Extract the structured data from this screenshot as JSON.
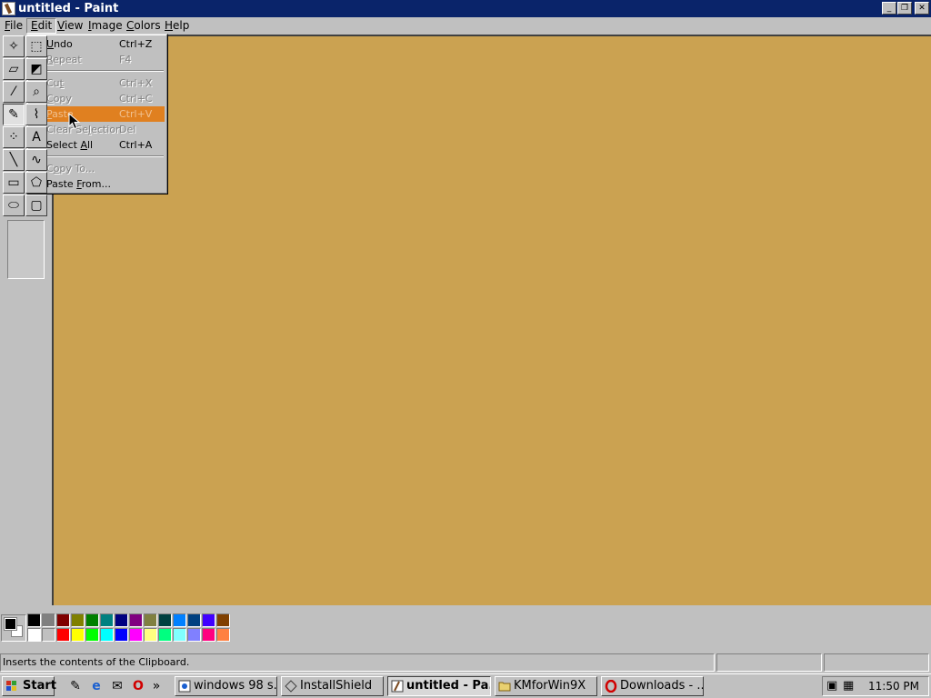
{
  "window": {
    "title": "untitled - Paint",
    "buttons": {
      "minimize": "_",
      "restore": "❐",
      "close": "✕"
    }
  },
  "menubar": {
    "file": {
      "first": "F",
      "rest": "ile"
    },
    "edit": {
      "first": "E",
      "rest": "dit"
    },
    "view": {
      "first": "V",
      "rest": "iew"
    },
    "image": {
      "first": "I",
      "rest": "mage"
    },
    "colors": {
      "first": "C",
      "rest": "olors"
    },
    "help": {
      "first": "H",
      "rest": "elp"
    }
  },
  "edit_menu": {
    "undo": {
      "first": "U",
      "rest": "ndo",
      "shortcut": "Ctrl+Z"
    },
    "repeat": {
      "first": "R",
      "rest": "epeat",
      "shortcut": "F4"
    },
    "cut": {
      "pre": "Cu",
      "ul": "t",
      "shortcut": "Ctrl+X"
    },
    "copy": {
      "first": "C",
      "rest": "opy",
      "shortcut": "Ctrl+C"
    },
    "paste": {
      "first": "P",
      "rest": "aste",
      "shortcut": "Ctrl+V"
    },
    "clear_selection": {
      "first": "",
      "pre": "Clear Se",
      "ul": "l",
      "post": "ection",
      "shortcut": "Del"
    },
    "select_all": {
      "pre": "Select ",
      "ul": "A",
      "post": "ll",
      "shortcut": "Ctrl+A"
    },
    "copy_to": {
      "pre": "C",
      "ul": "o",
      "post": "py To...",
      "shortcut": ""
    },
    "paste_from": {
      "pre": "Paste ",
      "ul": "F",
      "post": "rom...",
      "shortcut": ""
    }
  },
  "canvas": {
    "color": "#cba251"
  },
  "highlight_color": "#e08020",
  "tools": [
    {
      "name": "free-form-select-icon",
      "glyph": "✧"
    },
    {
      "name": "select-icon",
      "glyph": "⬚"
    },
    {
      "name": "eraser-icon",
      "glyph": "▱"
    },
    {
      "name": "fill-icon",
      "glyph": "◩"
    },
    {
      "name": "color-picker-icon",
      "glyph": "⁄"
    },
    {
      "name": "magnifier-icon",
      "glyph": "⌕"
    },
    {
      "name": "pencil-icon",
      "glyph": "✎"
    },
    {
      "name": "brush-icon",
      "glyph": "⌇"
    },
    {
      "name": "airbrush-icon",
      "glyph": "⁘"
    },
    {
      "name": "text-icon",
      "glyph": "A"
    },
    {
      "name": "line-icon",
      "glyph": "╲"
    },
    {
      "name": "curve-icon",
      "glyph": "∿"
    },
    {
      "name": "rectangle-icon",
      "glyph": "▭"
    },
    {
      "name": "polygon-icon",
      "glyph": "⬠"
    },
    {
      "name": "ellipse-icon",
      "glyph": "⬭"
    },
    {
      "name": "rounded-rectangle-icon",
      "glyph": "▢"
    }
  ],
  "palette": {
    "foreground": "#000000",
    "background": "#ffffff",
    "row1": [
      "#000000",
      "#808080",
      "#800000",
      "#808000",
      "#008000",
      "#008080",
      "#000080",
      "#800080",
      "#808040",
      "#004040",
      "#0080ff",
      "#004080",
      "#4000ff",
      "#804000"
    ],
    "row2": [
      "#ffffff",
      "#c0c0c0",
      "#ff0000",
      "#ffff00",
      "#00ff00",
      "#00ffff",
      "#0000ff",
      "#ff00ff",
      "#ffff80",
      "#00ff80",
      "#80ffff",
      "#8080ff",
      "#ff0080",
      "#ff8040"
    ]
  },
  "status": {
    "text": "Inserts the contents of the Clipboard."
  },
  "taskbar": {
    "start": "Start",
    "quicklaunch_more": "»",
    "tasks": [
      {
        "label": "windows 98 s...",
        "icon": "ie-page-icon"
      },
      {
        "label": "InstallShield",
        "icon": "installshield-icon"
      },
      {
        "label": "untitled - Pa...",
        "icon": "paint-icon"
      },
      {
        "label": "KMforWin9X",
        "icon": "folder-icon"
      },
      {
        "label": "Downloads - ...",
        "icon": "opera-icon"
      }
    ],
    "clock": "11:50 PM"
  }
}
